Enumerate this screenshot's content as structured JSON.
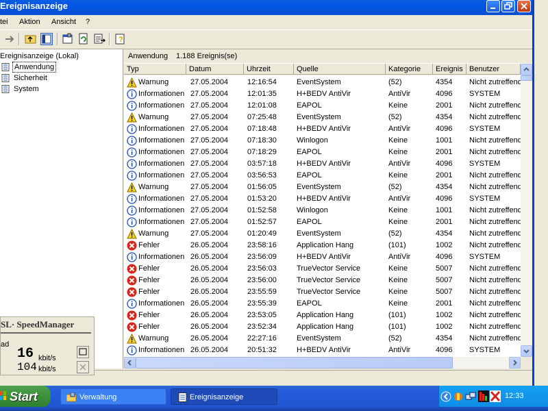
{
  "window": {
    "title": "Ereignisanzeige"
  },
  "menu": [
    "tei",
    "Aktion",
    "Ansicht",
    "?"
  ],
  "tree": {
    "root": "Ereignisanzeige (Lokal)",
    "items": [
      {
        "label": "Anwendung",
        "selected": true
      },
      {
        "label": "Sicherheit",
        "selected": false
      },
      {
        "label": "System",
        "selected": false
      }
    ]
  },
  "pane": {
    "header_name": "Anwendung",
    "header_count": "1.188 Ereignis(se)"
  },
  "columns": [
    "Typ",
    "Datum",
    "Uhrzeit",
    "Quelle",
    "Kategorie",
    "Ereignis",
    "Benutzer"
  ],
  "rows": [
    {
      "type": "warn",
      "typ": "Warnung",
      "datum": "27.05.2004",
      "zeit": "12:16:54",
      "quelle": "EventSystem",
      "kat": "(52)",
      "ereignis": "4354",
      "benutzer": "Nicht zutreffend"
    },
    {
      "type": "info",
      "typ": "Informationen",
      "datum": "27.05.2004",
      "zeit": "12:01:35",
      "quelle": "H+BEDV AntiVir",
      "kat": "AntiVir",
      "ereignis": "4096",
      "benutzer": "SYSTEM"
    },
    {
      "type": "info",
      "typ": "Informationen",
      "datum": "27.05.2004",
      "zeit": "12:01:08",
      "quelle": "EAPOL",
      "kat": "Keine",
      "ereignis": "2001",
      "benutzer": "Nicht zutreffend"
    },
    {
      "type": "warn",
      "typ": "Warnung",
      "datum": "27.05.2004",
      "zeit": "07:25:48",
      "quelle": "EventSystem",
      "kat": "(52)",
      "ereignis": "4354",
      "benutzer": "Nicht zutreffend"
    },
    {
      "type": "info",
      "typ": "Informationen",
      "datum": "27.05.2004",
      "zeit": "07:18:48",
      "quelle": "H+BEDV AntiVir",
      "kat": "AntiVir",
      "ereignis": "4096",
      "benutzer": "SYSTEM"
    },
    {
      "type": "info",
      "typ": "Informationen",
      "datum": "27.05.2004",
      "zeit": "07:18:30",
      "quelle": "Winlogon",
      "kat": "Keine",
      "ereignis": "1001",
      "benutzer": "Nicht zutreffend"
    },
    {
      "type": "info",
      "typ": "Informationen",
      "datum": "27.05.2004",
      "zeit": "07:18:29",
      "quelle": "EAPOL",
      "kat": "Keine",
      "ereignis": "2001",
      "benutzer": "Nicht zutreffend"
    },
    {
      "type": "info",
      "typ": "Informationen",
      "datum": "27.05.2004",
      "zeit": "03:57:18",
      "quelle": "H+BEDV AntiVir",
      "kat": "AntiVir",
      "ereignis": "4096",
      "benutzer": "SYSTEM"
    },
    {
      "type": "info",
      "typ": "Informationen",
      "datum": "27.05.2004",
      "zeit": "03:56:53",
      "quelle": "EAPOL",
      "kat": "Keine",
      "ereignis": "2001",
      "benutzer": "Nicht zutreffend"
    },
    {
      "type": "warn",
      "typ": "Warnung",
      "datum": "27.05.2004",
      "zeit": "01:56:05",
      "quelle": "EventSystem",
      "kat": "(52)",
      "ereignis": "4354",
      "benutzer": "Nicht zutreffend"
    },
    {
      "type": "info",
      "typ": "Informationen",
      "datum": "27.05.2004",
      "zeit": "01:53:20",
      "quelle": "H+BEDV AntiVir",
      "kat": "AntiVir",
      "ereignis": "4096",
      "benutzer": "SYSTEM"
    },
    {
      "type": "info",
      "typ": "Informationen",
      "datum": "27.05.2004",
      "zeit": "01:52:58",
      "quelle": "Winlogon",
      "kat": "Keine",
      "ereignis": "1001",
      "benutzer": "Nicht zutreffend"
    },
    {
      "type": "info",
      "typ": "Informationen",
      "datum": "27.05.2004",
      "zeit": "01:52:57",
      "quelle": "EAPOL",
      "kat": "Keine",
      "ereignis": "2001",
      "benutzer": "Nicht zutreffend"
    },
    {
      "type": "warn",
      "typ": "Warnung",
      "datum": "27.05.2004",
      "zeit": "01:20:49",
      "quelle": "EventSystem",
      "kat": "(52)",
      "ereignis": "4354",
      "benutzer": "Nicht zutreffend"
    },
    {
      "type": "error",
      "typ": "Fehler",
      "datum": "26.05.2004",
      "zeit": "23:58:16",
      "quelle": "Application Hang",
      "kat": "(101)",
      "ereignis": "1002",
      "benutzer": "Nicht zutreffend"
    },
    {
      "type": "info",
      "typ": "Informationen",
      "datum": "26.05.2004",
      "zeit": "23:56:09",
      "quelle": "H+BEDV AntiVir",
      "kat": "AntiVir",
      "ereignis": "4096",
      "benutzer": "SYSTEM"
    },
    {
      "type": "error",
      "typ": "Fehler",
      "datum": "26.05.2004",
      "zeit": "23:56:03",
      "quelle": "TrueVector Service",
      "kat": "Keine",
      "ereignis": "5007",
      "benutzer": "Nicht zutreffend"
    },
    {
      "type": "error",
      "typ": "Fehler",
      "datum": "26.05.2004",
      "zeit": "23:56:00",
      "quelle": "TrueVector Service",
      "kat": "Keine",
      "ereignis": "5007",
      "benutzer": "Nicht zutreffend"
    },
    {
      "type": "error",
      "typ": "Fehler",
      "datum": "26.05.2004",
      "zeit": "23:55:59",
      "quelle": "TrueVector Service",
      "kat": "Keine",
      "ereignis": "5007",
      "benutzer": "Nicht zutreffend"
    },
    {
      "type": "info",
      "typ": "Informationen",
      "datum": "26.05.2004",
      "zeit": "23:55:39",
      "quelle": "EAPOL",
      "kat": "Keine",
      "ereignis": "2001",
      "benutzer": "Nicht zutreffend"
    },
    {
      "type": "error",
      "typ": "Fehler",
      "datum": "26.05.2004",
      "zeit": "23:53:05",
      "quelle": "Application Hang",
      "kat": "(101)",
      "ereignis": "1002",
      "benutzer": "Nicht zutreffend"
    },
    {
      "type": "error",
      "typ": "Fehler",
      "datum": "26.05.2004",
      "zeit": "23:52:34",
      "quelle": "Application Hang",
      "kat": "(101)",
      "ereignis": "1002",
      "benutzer": "Nicht zutreffend"
    },
    {
      "type": "warn",
      "typ": "Warnung",
      "datum": "26.05.2004",
      "zeit": "22:27:16",
      "quelle": "EventSystem",
      "kat": "(52)",
      "ereignis": "4354",
      "benutzer": "Nicht zutreffend"
    },
    {
      "type": "info",
      "typ": "Informationen",
      "datum": "26.05.2004",
      "zeit": "20:51:32",
      "quelle": "H+BEDV AntiVir",
      "kat": "AntiVir",
      "ereignis": "4096",
      "benutzer": "SYSTEM"
    }
  ],
  "speed": {
    "title": "SL·  SpeedManager",
    "side_label": "ad",
    "down_value": "16",
    "up_value": "104",
    "unit": "kbit/s"
  },
  "taskbar": {
    "start": "Start",
    "tasks": [
      {
        "label": "Verwaltung",
        "active": false
      },
      {
        "label": "Ereignisanzeige",
        "active": true
      }
    ],
    "clock": "12:33"
  },
  "colors": {
    "titlebar": "#0054E3",
    "taskbar": "#245EDC",
    "start": "#3C913C",
    "tray": "#0F8CE6",
    "error": "#D6271C",
    "warn": "#F7D117",
    "info": "#1E4FB8"
  }
}
